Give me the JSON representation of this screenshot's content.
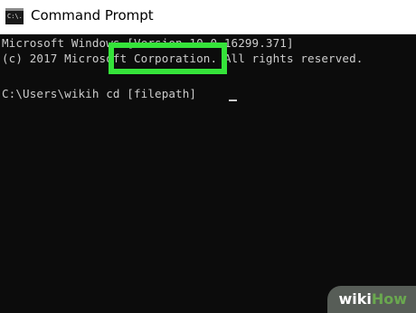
{
  "window": {
    "title": "Command Prompt",
    "icon": "command-prompt-icon",
    "icon_text": "C:\\."
  },
  "console": {
    "lines": [
      "Microsoft Windows [Version 10.0.16299.371]",
      "(c) 2017 Microsoft Corporation. All rights reserved.",
      "C:\\Users\\wikih cd [filepath]"
    ],
    "highlight_color": "#35e33a",
    "background": "#0c0c0c",
    "text_color": "#cccccc"
  },
  "watermark": {
    "part1": "wiki",
    "part2": "How"
  }
}
